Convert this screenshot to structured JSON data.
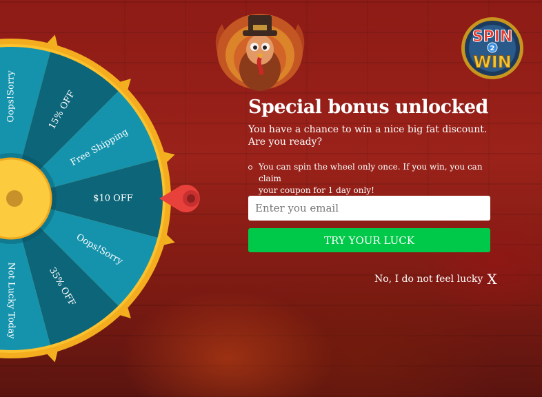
{
  "popup": {
    "title": "Special bonus unlocked",
    "subtitle_line1": "You have a chance to win a nice big fat discount.",
    "subtitle_line2": "Are you ready?",
    "note_line1": "You can spin the wheel only once. If you win, you can claim",
    "note_line2": "your coupon for 1 day only!",
    "email_placeholder": "Enter you email",
    "try_button": "TRY YOUR LUCK",
    "decline_text": "No, I do not feel lucky",
    "decline_x": "X"
  },
  "logo": {
    "line1": "SPIN",
    "mid": "2",
    "line2": "WIN"
  },
  "wheel": {
    "segments": [
      {
        "label": "Oops!Sorry",
        "color": "#1593ad"
      },
      {
        "label": "15% OFF",
        "color": "#0d6579"
      },
      {
        "label": "Free Shipping",
        "color": "#1593ad"
      },
      {
        "label": "$10 OFF",
        "color": "#0d6579"
      },
      {
        "label": "Oops!Sorry",
        "color": "#1593ad"
      },
      {
        "label": "35% OFF",
        "color": "#0d6579"
      },
      {
        "label": "Not Lucky Today",
        "color": "#1593ad"
      }
    ]
  },
  "colors": {
    "accent_green": "#00c94a",
    "wheel_rim": "#f7b520",
    "pointer": "#e8413c"
  },
  "icons": {
    "pointer": "wheel-pointer-icon",
    "turkey": "turkey-pilgrim-icon",
    "logo": "spin-2-win-logo"
  }
}
